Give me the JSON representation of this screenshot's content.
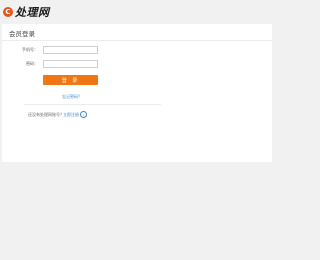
{
  "header": {
    "logo_mark": "C",
    "logo_text": "处理网"
  },
  "panel": {
    "title": "会员登录"
  },
  "form": {
    "username_label": "手机号：",
    "username_value": "",
    "password_label": "密码：",
    "password_value": "",
    "login_button": "登 录",
    "forgot_link": "忘记密码？"
  },
  "register": {
    "prompt": "还没有处理网账号？",
    "link": "立即注册",
    "icon": "right-arrow-icon"
  },
  "colors": {
    "brand": "#e8551c",
    "button": "#f07613",
    "link": "#3a86c8"
  }
}
